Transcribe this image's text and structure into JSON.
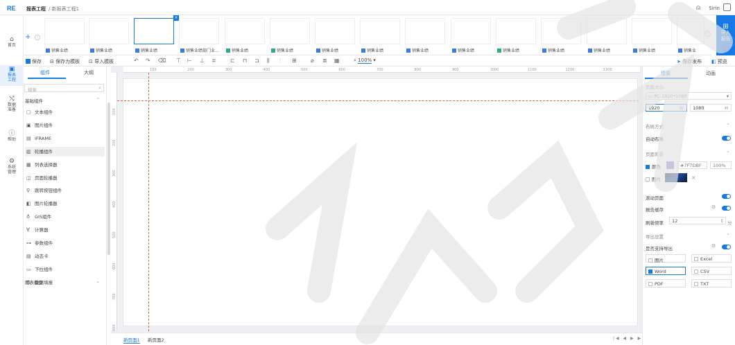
{
  "header": {
    "logo": "RE",
    "project": "报表工程",
    "breadcrumb": "/ 新报表工程1",
    "user": "Sirin"
  },
  "nav": [
    {
      "label": "首页",
      "icon": "home-icon"
    },
    {
      "label": "报表工程",
      "icon": "report-icon"
    },
    {
      "label": "数据准备",
      "icon": "data-icon"
    },
    {
      "label": "帮助",
      "icon": "help-icon"
    },
    {
      "label": "系统管理",
      "icon": "settings-icon"
    }
  ],
  "thumbs": [
    "销售业绩",
    "销售业绩",
    "销售业绩",
    "销售业绩部门业...",
    "销售业绩",
    "销售业绩",
    "销售业绩",
    "销售业绩",
    "销售业绩",
    "销售业绩",
    "销售业绩",
    "销售业绩",
    "销售业绩",
    "销售业绩",
    "销售业"
  ],
  "import_label": "导入报告",
  "toolbar": {
    "save": "保存",
    "save_as_template": "保存为模板",
    "import_template": "导入模板",
    "zoom": "100%",
    "publish": "保存发布",
    "preview": "预览"
  },
  "left_panel": {
    "tab_components": "组件",
    "tab_outline": "大纲",
    "search_placeholder": "搜索",
    "group_basic": "基础组件",
    "components": [
      "文本组件",
      "图片组件",
      "IFRAME",
      "轮播组件",
      "列表选择器",
      "页面轮播器",
      "跳转按钮组件",
      "图片轮播器",
      "GIS组件",
      "计算器",
      "参数组件",
      "动态卡",
      "下拉组件",
      "数据填报"
    ],
    "group_chart": "图表模型"
  },
  "ruler_h": [
    "100",
    "200",
    "300",
    "400",
    "500",
    "600",
    "700",
    "800",
    "900",
    "1000",
    "1100",
    "1200",
    "1300"
  ],
  "ruler_v": [
    "100",
    "200",
    "300",
    "400",
    "500",
    "600",
    "700",
    "800"
  ],
  "page_tabs": [
    "新页面1",
    "新页面2"
  ],
  "pager": "|◀ ◀ ▶ ▶|",
  "right_panel": {
    "tab_settings": "设置",
    "tab_animation": "动画",
    "page_size_label": "页面大小",
    "page_size_value": "PC-1920*1080",
    "width": "1920",
    "width_unit": "W",
    "height": "1080",
    "height_unit": "H",
    "layout_label": "布局方式",
    "auto_layout": "自动布局",
    "bg_label": "页面背景",
    "bg_color": "颜色",
    "bg_color_hex": "#7F7DBF",
    "bg_opacity": "100%",
    "bg_image": "图片",
    "scroll_page": "滚动页面",
    "report_cache": "报告缓存",
    "refresh_rate": "刷新频率",
    "refresh_value": "12",
    "refresh_unit": "分",
    "export_label": "导出设置",
    "export_enable": "是否支持导出",
    "export_formats": [
      "图片",
      "Excel",
      "Word",
      "CSV",
      "PDF",
      "TXT"
    ]
  }
}
